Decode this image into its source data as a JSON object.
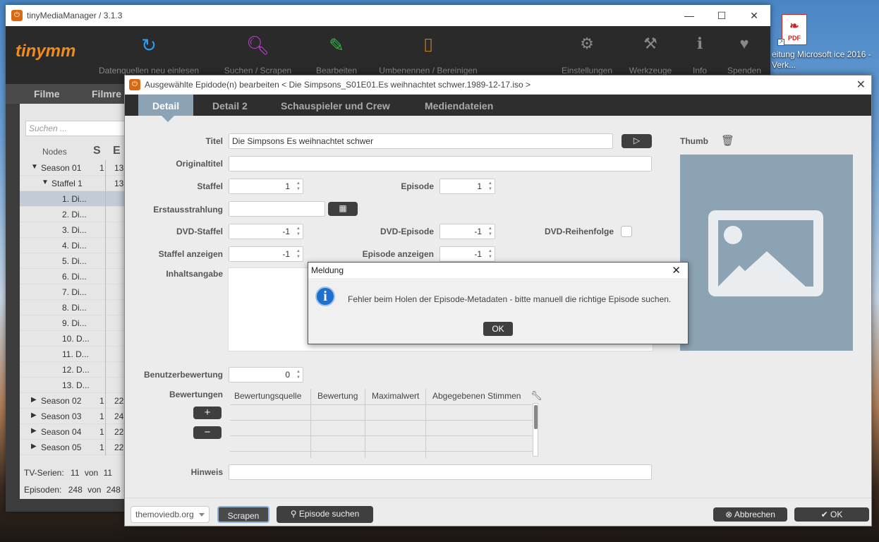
{
  "desktop": {
    "pdf_label": "PDF",
    "file_label": "eitung Microsoft ice 2016 - Verk..."
  },
  "main_window": {
    "title": "tinyMediaManager / 3.1.3",
    "logo": "tinymm",
    "toolbar": [
      {
        "name": "Datenquellen neu einlesen",
        "icon": "refresh-icon",
        "color": "#2a9df4"
      },
      {
        "name": "Suchen / Scrapen",
        "icon": "search-scrape-icon",
        "color": "#c43ed8"
      },
      {
        "name": "Bearbeiten",
        "icon": "edit-icon",
        "color": "#33b24a"
      },
      {
        "name": "Umbenennen / Bereinigen",
        "icon": "rename-icon",
        "color": "#ef8c1a"
      },
      {
        "name": "Einstellungen",
        "icon": "gear-icon",
        "color": "#888888"
      },
      {
        "name": "Werkzeuge",
        "icon": "tools-icon",
        "color": "#888888"
      },
      {
        "name": "Info",
        "icon": "info-icon",
        "color": "#888888"
      },
      {
        "name": "Spenden",
        "icon": "heart-icon",
        "color": "#888888"
      }
    ],
    "menu": [
      "Filme",
      "Filmre"
    ],
    "search_placeholder": "Suchen ...",
    "tree_headers": {
      "nodes": "Nodes",
      "s": "S",
      "e": "E"
    },
    "tree_rows": [
      {
        "name": "Season 01",
        "s": "1",
        "e": "13",
        "expanded": true
      },
      {
        "name": "Staffel 1",
        "s": "",
        "e": "13",
        "expanded": true
      },
      {
        "name": "1. Di...",
        "s": "",
        "e": "",
        "selected": true
      },
      {
        "name": "2. Di...",
        "s": "",
        "e": ""
      },
      {
        "name": "3. Di...",
        "s": "",
        "e": ""
      },
      {
        "name": "4. Di...",
        "s": "",
        "e": ""
      },
      {
        "name": "5. Di...",
        "s": "",
        "e": ""
      },
      {
        "name": "6. Di...",
        "s": "",
        "e": ""
      },
      {
        "name": "7. Di...",
        "s": "",
        "e": ""
      },
      {
        "name": "8. Di...",
        "s": "",
        "e": ""
      },
      {
        "name": "9. Di...",
        "s": "",
        "e": ""
      },
      {
        "name": "10. D...",
        "s": "",
        "e": ""
      },
      {
        "name": "11. D...",
        "s": "",
        "e": ""
      },
      {
        "name": "12. D...",
        "s": "",
        "e": ""
      },
      {
        "name": "13. D...",
        "s": "",
        "e": ""
      },
      {
        "name": "Season 02",
        "s": "1",
        "e": "22",
        "expanded": false
      },
      {
        "name": "Season 03",
        "s": "1",
        "e": "24",
        "expanded": false
      },
      {
        "name": "Season 04",
        "s": "1",
        "e": "22",
        "expanded": false
      },
      {
        "name": "Season 05",
        "s": "1",
        "e": "22",
        "expanded": false
      }
    ],
    "stats": {
      "tv_label": "TV-Serien:",
      "tv_value": "11",
      "tv_von": "von",
      "tv_total": "11",
      "ep_label": "Episoden:",
      "ep_value": "248",
      "ep_von": "von",
      "ep_total": "248"
    }
  },
  "edit_dialog": {
    "title": "Ausgewählte Epidode(n) bearbeiten  < Die Simpsons_S01E01.Es weihnachtet schwer.1989-12-17.iso >",
    "tabs": [
      "Detail",
      "Detail 2",
      "Schauspieler und Crew",
      "Mediendateien"
    ],
    "labels": {
      "titel": "Titel",
      "originaltitel": "Originaltitel",
      "staffel": "Staffel",
      "episode": "Episode",
      "erstausstrahlung": "Erstausstrahlung",
      "dvd_staffel": "DVD-Staffel",
      "dvd_episode": "DVD-Episode",
      "dvd_reihenfolge": "DVD-Reihenfolge",
      "staffel_anzeigen": "Staffel anzeigen",
      "episode_anzeigen": "Episode anzeigen",
      "inhaltsangabe": "Inhaltsangabe",
      "benutzerbewertung": "Benutzerbewertung",
      "bewertungen": "Bewertungen",
      "hinweis": "Hinweis",
      "thumb": "Thumb"
    },
    "values": {
      "titel": "Die Simpsons Es weihnachtet schwer",
      "originaltitel": "",
      "staffel": "1",
      "episode": "1",
      "erstausstrahlung": "",
      "dvd_staffel": "-1",
      "dvd_episode": "-1",
      "staffel_anzeigen": "-1",
      "episode_anzeigen": "-1",
      "benutzerbewertung": "0",
      "hinweis": ""
    },
    "ratings_columns": [
      "Bewertungsquelle",
      "Bewertung",
      "Maximalwert",
      "Abgegebenen Stimmen"
    ],
    "buttons": {
      "add": "+",
      "remove": "−",
      "scraper": "themoviedb.org",
      "scrapen": "Scrapen",
      "episode_suchen": "Episode suchen",
      "abbrechen": "Abbrechen",
      "ok": "OK"
    }
  },
  "message_box": {
    "title": "Meldung",
    "text": "Fehler beim Holen der Episode-Metadaten - bitte manuell die richtige Episode suchen.",
    "ok": "OK"
  }
}
